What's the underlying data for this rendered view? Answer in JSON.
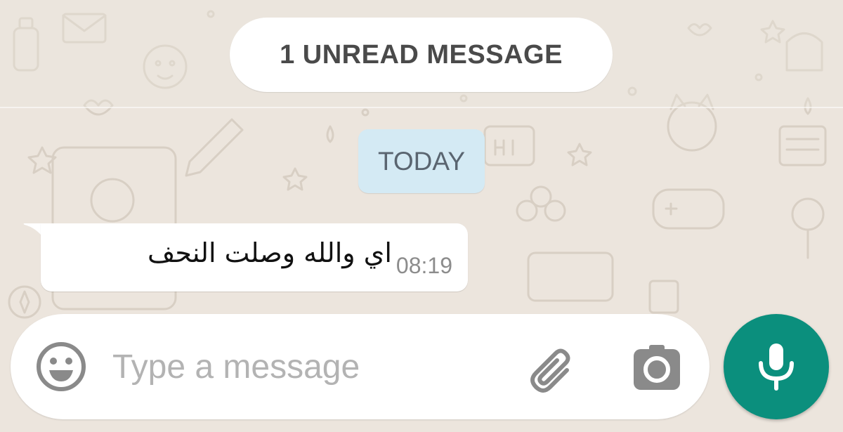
{
  "banner": {
    "unread_label": "1 UNREAD MESSAGE"
  },
  "date_chip": {
    "label": "TODAY"
  },
  "messages": [
    {
      "direction": "incoming",
      "text": "اي والله وصلت النحف",
      "time": "08:19"
    }
  ],
  "composer": {
    "placeholder": "Type a message",
    "value": "",
    "icons": [
      "smiley-icon",
      "paperclip-icon",
      "camera-icon",
      "microphone-icon"
    ]
  },
  "colors": {
    "background": "#ece5dd",
    "bubble_incoming": "#ffffff",
    "date_chip": "#d4eaf4",
    "accent": "#0b8f7d",
    "icon_gray": "#8a8a8a",
    "time_text": "#8c8c8c"
  }
}
